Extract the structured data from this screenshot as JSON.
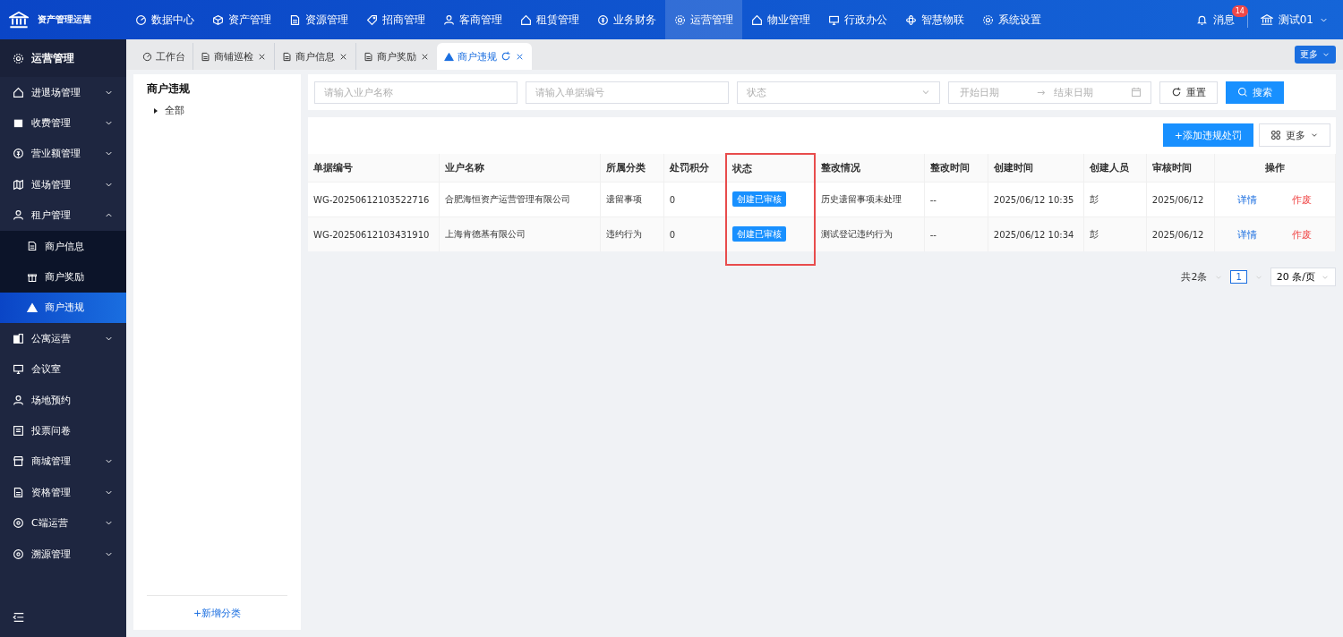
{
  "app": {
    "title": "资产管理运营"
  },
  "top_nav": [
    {
      "label": "数据中心",
      "selected": false
    },
    {
      "label": "资产管理",
      "selected": false
    },
    {
      "label": "资源管理",
      "selected": false
    },
    {
      "label": "招商管理",
      "selected": false
    },
    {
      "label": "客商管理",
      "selected": false
    },
    {
      "label": "租赁管理",
      "selected": false
    },
    {
      "label": "业务财务",
      "selected": false
    },
    {
      "label": "运营管理",
      "selected": true
    },
    {
      "label": "物业管理",
      "selected": false
    },
    {
      "label": "行政办公",
      "selected": false
    },
    {
      "label": "智慧物联",
      "selected": false
    },
    {
      "label": "系统设置",
      "selected": false
    }
  ],
  "header_right": {
    "messages": "消息",
    "badge": "14",
    "user": "测试01"
  },
  "sidebar": {
    "title": "运营管理",
    "items": [
      {
        "label": "进退场管理",
        "kind": "group",
        "expanded": false
      },
      {
        "label": "收费管理",
        "kind": "group",
        "expanded": false
      },
      {
        "label": "营业额管理",
        "kind": "group",
        "expanded": false
      },
      {
        "label": "巡场管理",
        "kind": "group",
        "expanded": false
      },
      {
        "label": "租户管理",
        "kind": "group",
        "expanded": true,
        "children": [
          {
            "label": "商户信息",
            "selected": false
          },
          {
            "label": "商户奖励",
            "selected": false
          },
          {
            "label": "商户违规",
            "selected": true
          }
        ]
      },
      {
        "label": "公寓运营",
        "kind": "group",
        "expanded": false
      },
      {
        "label": "会议室",
        "kind": "link"
      },
      {
        "label": "场地预约",
        "kind": "link"
      },
      {
        "label": "投票问卷",
        "kind": "link"
      },
      {
        "label": "商城管理",
        "kind": "group",
        "expanded": false
      },
      {
        "label": "资格管理",
        "kind": "group",
        "expanded": false
      },
      {
        "label": "C端运营",
        "kind": "group",
        "expanded": false
      },
      {
        "label": "溯源管理",
        "kind": "group",
        "expanded": false
      }
    ]
  },
  "tabs": [
    {
      "label": "工作台",
      "selected": false,
      "closable": false
    },
    {
      "label": "商铺巡检",
      "selected": false,
      "closable": true
    },
    {
      "label": "商户信息",
      "selected": false,
      "closable": true
    },
    {
      "label": "商户奖励",
      "selected": false,
      "closable": true
    },
    {
      "label": "商户违规",
      "selected": true,
      "closable": true
    }
  ],
  "tabs_more": "更多",
  "category_panel": {
    "title": "商户违规",
    "tree": [
      {
        "label": "全部",
        "expanded": false
      }
    ],
    "add": "+新增分类"
  },
  "filters": {
    "name": {
      "placeholder": "请输入业户名称"
    },
    "number": {
      "placeholder": "请输入单据编号"
    },
    "status": {
      "placeholder": "状态"
    },
    "start": {
      "placeholder": "开始日期"
    },
    "separator": "→",
    "end": {
      "placeholder": "结束日期"
    },
    "reset": "重置",
    "search": "搜索"
  },
  "toolbar": {
    "add": "+添加违规处罚",
    "more": "更多"
  },
  "table": {
    "columns": [
      {
        "label": "单据编号",
        "highlighted": false
      },
      {
        "label": "业户名称",
        "highlighted": false
      },
      {
        "label": "所属分类",
        "highlighted": false
      },
      {
        "label": "处罚积分",
        "highlighted": false
      },
      {
        "label": "状态",
        "highlighted": true
      },
      {
        "label": "整改情况",
        "highlighted": false
      },
      {
        "label": "整改时间",
        "highlighted": false
      },
      {
        "label": "创建时间",
        "highlighted": false
      },
      {
        "label": "创建人员",
        "highlighted": false
      },
      {
        "label": "审核时间",
        "highlighted": false
      },
      {
        "label": "操作",
        "highlighted": false
      }
    ],
    "rows": [
      {
        "cells": [
          "WG-20250612103522716",
          "合肥海恒资产运营管理有限公司",
          "遗留事项",
          "0",
          "创建已审核",
          "历史遗留事项未处理",
          "--",
          "2025/06/12 10:35",
          "彭",
          "2025/06/12"
        ],
        "actions": [
          "详情",
          "作废"
        ]
      },
      {
        "cells": [
          "WG-20250612103431910",
          "上海肯德基有限公司",
          "违约行为",
          "0",
          "创建已审核",
          "测试登记违约行为",
          "--",
          "2025/06/12 10:34",
          "彭",
          "2025/06/12"
        ],
        "actions": [
          "详情",
          "作废"
        ]
      }
    ]
  },
  "pagination": {
    "total": "共2条",
    "pages": [
      {
        "label": "1",
        "selected": true
      }
    ],
    "page_size": "20 条/页"
  }
}
